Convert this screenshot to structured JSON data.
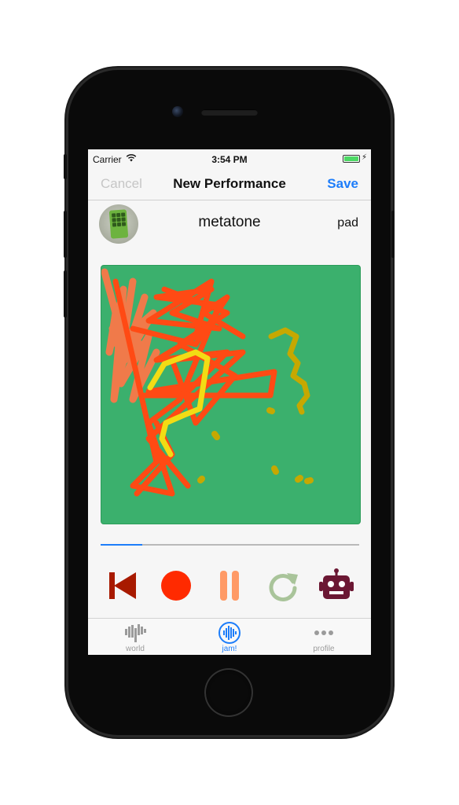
{
  "status_bar": {
    "carrier": "Carrier",
    "time": "3:54 PM",
    "battery_color": "#4cd964"
  },
  "nav": {
    "cancel_label": "Cancel",
    "title": "New Performance",
    "save_label": "Save",
    "accent_color": "#1d7dfa"
  },
  "instrument": {
    "name": "metatone",
    "type": "pad",
    "avatar_icon": "instrument-avatar"
  },
  "drawing_canvas": {
    "background_color": "#3bb06d",
    "stroke_colors": [
      "#ff4a14",
      "#f07a4a",
      "#f2dc14",
      "#c6a800"
    ]
  },
  "playback": {
    "progress": 0.16
  },
  "controls": [
    {
      "name": "skip-back",
      "icon": "skip-back-icon",
      "color": "#a81a00"
    },
    {
      "name": "record",
      "icon": "record-icon",
      "color": "#ff2a00"
    },
    {
      "name": "pause",
      "icon": "pause-icon",
      "color": "#ff9a66"
    },
    {
      "name": "replay",
      "icon": "replay-icon",
      "color": "#a9c49a"
    },
    {
      "name": "robot",
      "icon": "robot-icon",
      "color": "#6b1733"
    }
  ],
  "tabs": [
    {
      "label": "world",
      "icon": "world-icon",
      "active": false
    },
    {
      "label": "jam!",
      "icon": "jam-icon",
      "active": true
    },
    {
      "label": "profile",
      "icon": "more-icon",
      "active": false
    }
  ]
}
